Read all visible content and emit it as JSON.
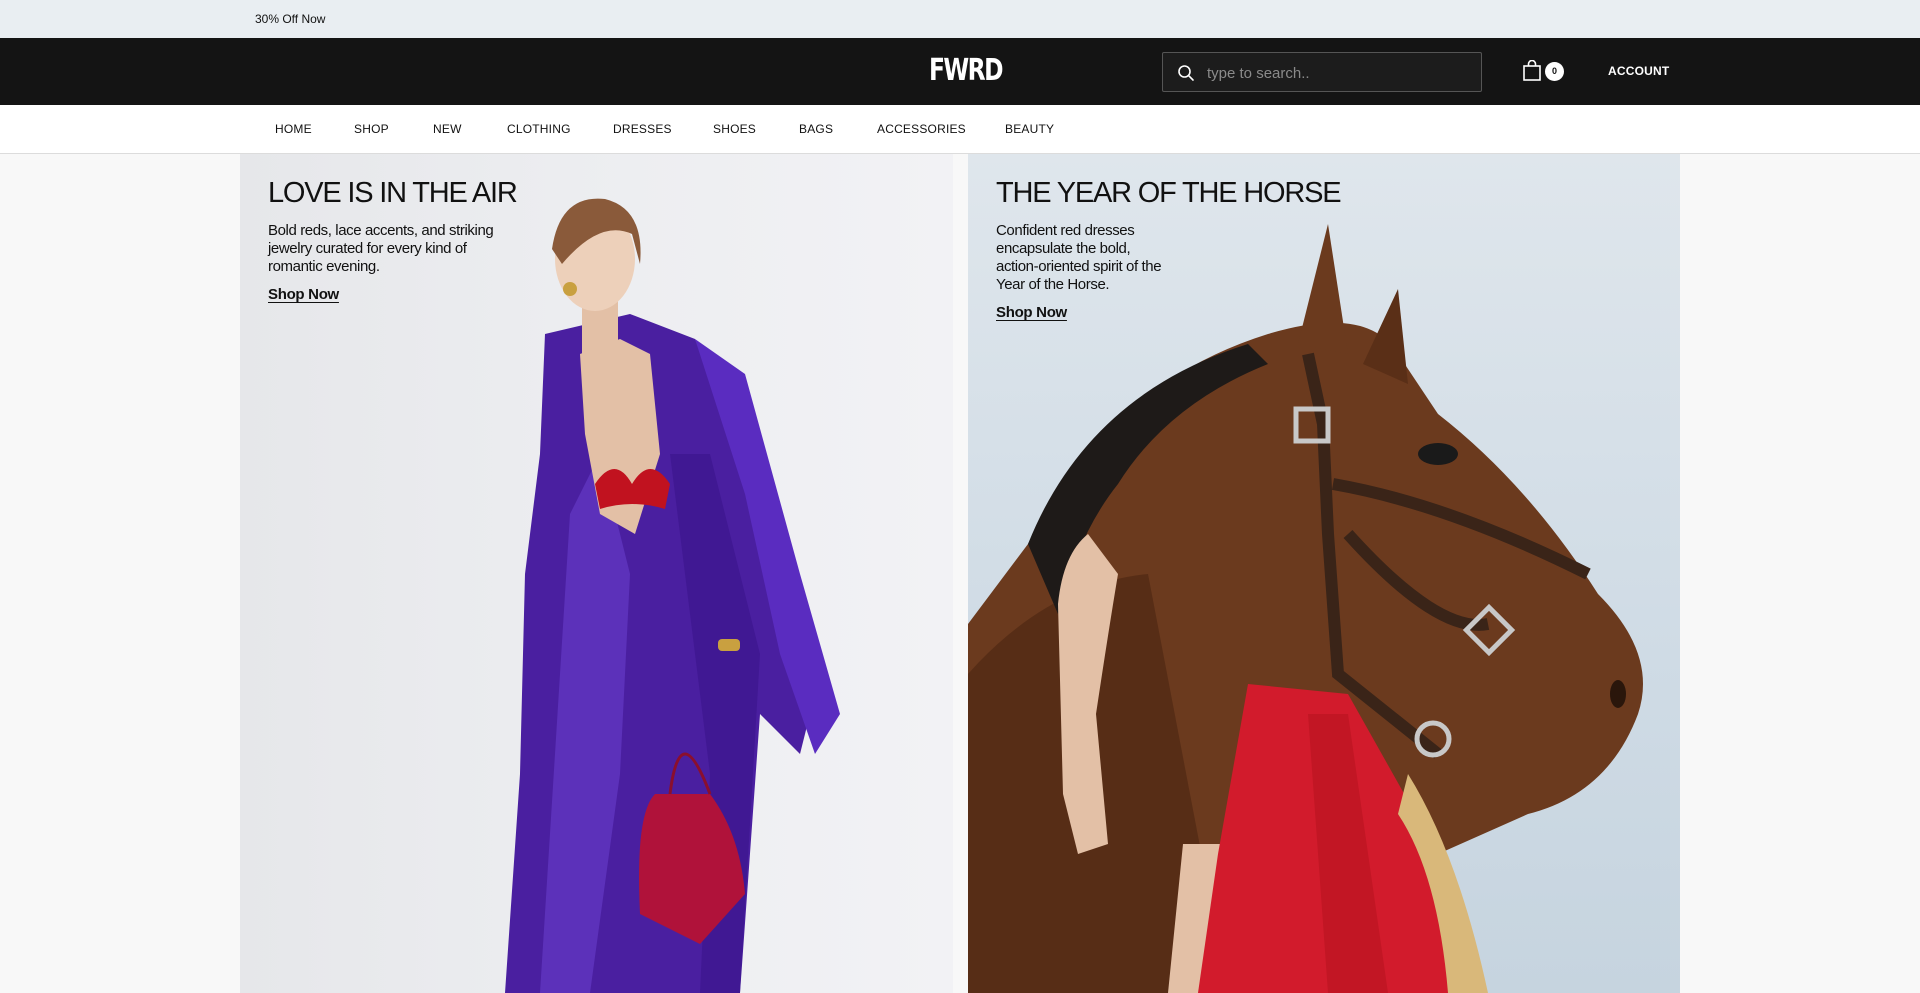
{
  "promo": {
    "text": "30% Off Now"
  },
  "header": {
    "logo": "FWRD",
    "search": {
      "placeholder": "type to search.."
    },
    "cart": {
      "count": "0"
    },
    "account_label": "ACCOUNT"
  },
  "nav": {
    "items": [
      {
        "label": "HOME"
      },
      {
        "label": "SHOP"
      },
      {
        "label": "NEW"
      },
      {
        "label": "CLOTHING"
      },
      {
        "label": "DRESSES"
      },
      {
        "label": "SHOES"
      },
      {
        "label": "BAGS"
      },
      {
        "label": "ACCESSORIES"
      },
      {
        "label": "BEAUTY"
      }
    ]
  },
  "hero": {
    "left": {
      "title": "LOVE IS IN THE AIR",
      "subtitle": "Bold reds, lace accents, and striking jewelry curated for every kind of romantic evening.",
      "cta": "Shop Now"
    },
    "right": {
      "title": "THE YEAR OF THE HORSE",
      "subtitle": "Confident red dresses encapsulate the bold, action-oriented spirit of the Year of the Horse.",
      "cta": "Shop Now"
    }
  },
  "colors": {
    "header_bg": "#141414",
    "promo_bg": "#e9eef2",
    "dress_purple": "#4a1fa0",
    "accent_red": "#d21b2c",
    "horse_brown": "#6b3a1e"
  }
}
